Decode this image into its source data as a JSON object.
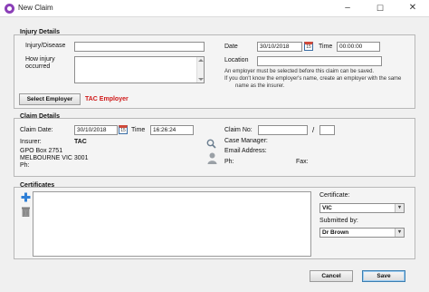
{
  "window": {
    "title": "New Claim",
    "minimize": "–",
    "maximize": "☐",
    "close": "✕"
  },
  "injury": {
    "section_title": "Injury Details",
    "injury_label": "Injury/Disease",
    "injury_value": "",
    "how_label_1": "How injury",
    "how_label_2": "occurred",
    "how_value": "",
    "date_label": "Date",
    "date_value": "30/10/2018",
    "time_label": "Time",
    "time_value": "00:00:00",
    "location_label": "Location",
    "location_value": "",
    "note_line1": "An employer must be selected before this claim can be saved.",
    "note_line2": "If you don't know the employer's name, create an employer with the same",
    "note_line3": "name as the insurer.",
    "select_employer": "Select Employer",
    "employer_name": "TAC Employer"
  },
  "claim": {
    "section_title": "Claim Details",
    "claim_date_label": "Claim Date:",
    "claim_date_value": "30/10/2018",
    "time_label": "Time",
    "time_value": "16:26:24",
    "insurer_label": "Insurer:",
    "insurer_value": "TAC",
    "address_line1": "GPO Box 2751",
    "address_line2": "MELBOURNE VIC 3001",
    "ph_label": "Ph:",
    "claim_no_label": "Claim No:",
    "claim_no_value": "",
    "claim_no_sep": "/",
    "claim_no_value2": "",
    "case_manager_label": "Case Manager:",
    "email_label": "Email Address:",
    "ph2_label": "Ph:",
    "fax_label": "Fax:"
  },
  "certificates": {
    "section_title": "Certificates",
    "certificate_label": "Certificate:",
    "certificate_value": "VIC",
    "submitted_label": "Submitted by:",
    "submitted_value": "Dr Brown"
  },
  "footer": {
    "cancel": "Cancel",
    "save": "Save"
  },
  "colors": {
    "accent": "#8b3fb8",
    "employer": "#d01818",
    "add_icon": "#2f7fd6"
  }
}
